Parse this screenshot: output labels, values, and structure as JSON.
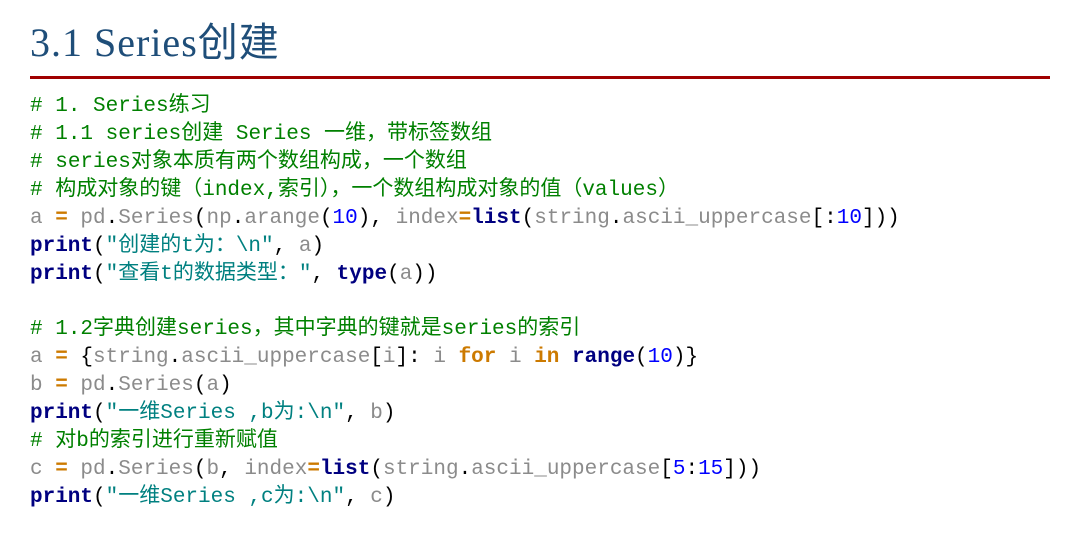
{
  "title": "3.1 Series创建",
  "code": {
    "c1": {
      "prefix": "# ",
      "text": "1. Series练习"
    },
    "c2": {
      "prefix": "# ",
      "text": "1.1 series创建 Series 一维，带标签数组"
    },
    "c3": {
      "prefix": "# ",
      "text": "series对象本质有两个数组构成，一个数组"
    },
    "c4": {
      "prefix": "# ",
      "text": "构成对象的键（index,索引），一个数组构成对象的值（values）"
    },
    "l5": {
      "v": "a",
      "eq": " = ",
      "mod1": "pd",
      "dot1": ".",
      "fn1": "Series",
      "op1": "(",
      "mod2": "np",
      "dot2": ".",
      "fn2": "arange",
      "op2": "(",
      "num1": "10",
      "cp1": ")",
      "comma1": ", ",
      "kw1": "index",
      "eq2": "=",
      "bi1": "list",
      "op3": "(",
      "mod3": "string",
      "dot3": ".",
      "attr1": "ascii_uppercase",
      "br1": "[",
      "colon1": ":",
      "num2": "10",
      "br2": "]",
      "cp2": ")",
      "cp3": ")"
    },
    "l6": {
      "bi": "print",
      "op": "(",
      "s1": "\"创建的t为：\\n\"",
      "comma": ", ",
      "v": "a",
      "cp": ")"
    },
    "l7": {
      "bi": "print",
      "op": "(",
      "s1": "\"查看t的数据类型：\"",
      "comma": ", ",
      "bi2": "type",
      "op2": "(",
      "v": "a",
      "cp2": ")",
      "cp": ")"
    },
    "blank1": " ",
    "c8": {
      "prefix": "# ",
      "text": "1.2字典创建series，其中字典的键就是series的索引"
    },
    "l9": {
      "v": "a",
      "eq": " = ",
      "br1": "{",
      "mod1": "string",
      "dot1": ".",
      "attr1": "ascii_uppercase",
      "br2": "[",
      "i1": "i",
      "br3": "]",
      "colon": ": ",
      "i2": "i",
      "sp": " ",
      "kw1": "for",
      "sp2": " ",
      "i3": "i",
      "sp3": " ",
      "kw2": "in",
      "sp4": " ",
      "bi": "range",
      "op": "(",
      "num": "10",
      "cp": ")",
      "br4": "}"
    },
    "l10": {
      "v": "b",
      "eq": " = ",
      "mod1": "pd",
      "dot1": ".",
      "fn1": "Series",
      "op1": "(",
      "v2": "a",
      "cp1": ")"
    },
    "l11": {
      "bi": "print",
      "op": "(",
      "s1": "\"一维Series ,b为:\\n\"",
      "comma": ", ",
      "v": "b",
      "cp": ")"
    },
    "c12": {
      "prefix": "# ",
      "text": "对b的索引进行重新赋值"
    },
    "l13": {
      "v": "c",
      "eq": " = ",
      "mod1": "pd",
      "dot1": ".",
      "fn1": "Series",
      "op1": "(",
      "v2": "b",
      "comma1": ", ",
      "kw1": "index",
      "eq2": "=",
      "bi1": "list",
      "op2": "(",
      "mod2": "string",
      "dot2": ".",
      "attr1": "ascii_uppercase",
      "br1": "[",
      "num1": "5",
      "colon1": ":",
      "num2": "15",
      "br2": "]",
      "cp2": ")",
      "cp1": ")"
    },
    "l14": {
      "bi": "print",
      "op": "(",
      "s1": "\"一维Series ,c为:\\n\"",
      "comma": ", ",
      "v": "c",
      "cp": ")"
    }
  }
}
